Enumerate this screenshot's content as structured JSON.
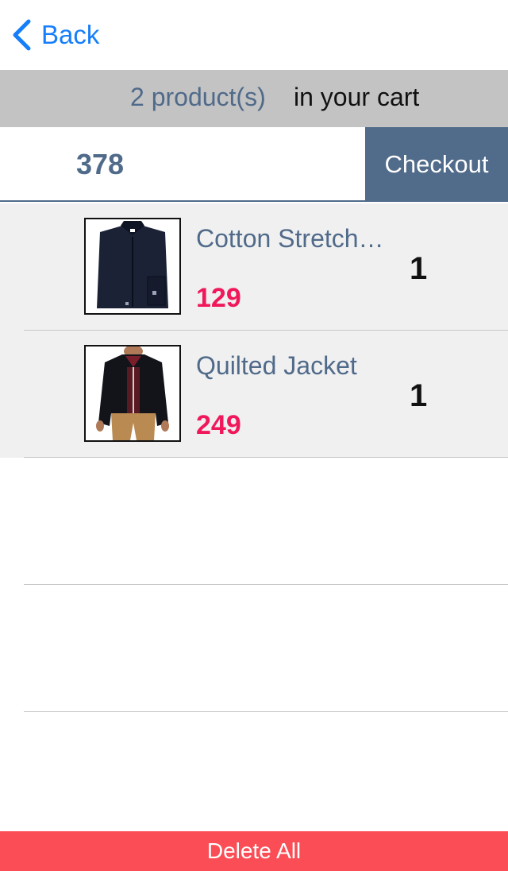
{
  "nav": {
    "back_label": "Back",
    "back_icon": "chevron-left-icon"
  },
  "summary": {
    "count_text": "2 product(s)",
    "suffix_text": "in your cart"
  },
  "total": {
    "value": "378",
    "checkout_label": "Checkout"
  },
  "cart": {
    "items": [
      {
        "name": "Cotton Stretch…",
        "price": "129",
        "quantity": "1",
        "image": "navy-shirt-image"
      },
      {
        "name": "Quilted Jacket",
        "price": "249",
        "quantity": "1",
        "image": "black-jacket-image"
      }
    ]
  },
  "footer": {
    "delete_all_label": "Delete All"
  },
  "colors": {
    "accent_blue": "#157efb",
    "slate": "#506a8a",
    "price_pink": "#f0185a",
    "delete_red": "#fb4d55",
    "summary_gray": "#c3c3c3",
    "row_gray": "#f0f0f0"
  }
}
